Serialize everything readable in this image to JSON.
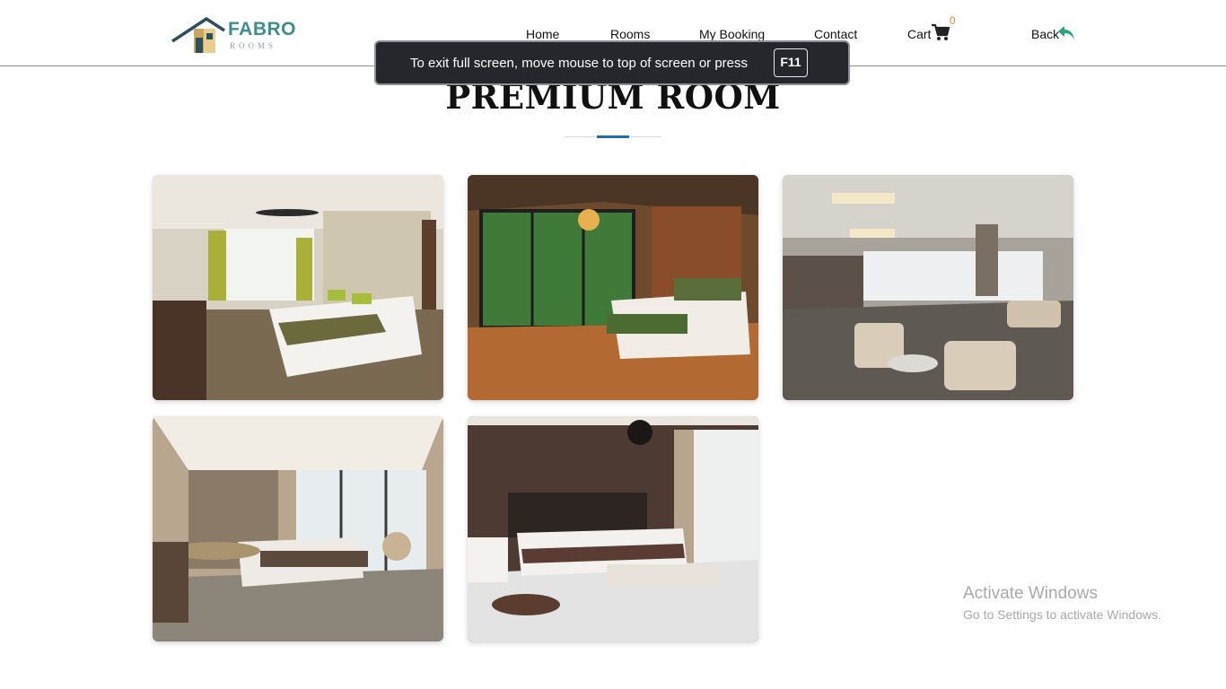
{
  "brand": {
    "name": "FABRO",
    "subtitle": "ROOMS"
  },
  "nav": {
    "home": "Home",
    "rooms": "Rooms",
    "my_booking": "My Booking",
    "contact": "Contact",
    "cart": "Cart",
    "cart_count": "0",
    "back": "Back"
  },
  "fullscreen_toast": {
    "message": "To exit full screen, move mouse to top of screen or press",
    "key": "F11"
  },
  "page": {
    "title": "PREMIUM ROOM"
  },
  "gallery": [
    {
      "scene": "bedroom-with-ceiling-fan"
    },
    {
      "scene": "bedroom-with-forest-view"
    },
    {
      "scene": "hotel-lounge"
    },
    {
      "scene": "modern-bedroom-with-window-view"
    },
    {
      "scene": "bedroom-with-chandelier"
    }
  ],
  "watermark": {
    "title": "Activate Windows",
    "subtitle": "Go to Settings to activate Windows."
  },
  "colors": {
    "brand": "#3d8f8d",
    "accent_rule": "#1f6fb0",
    "cart_count": "#e0873a",
    "back_icon": "#2aa383"
  }
}
